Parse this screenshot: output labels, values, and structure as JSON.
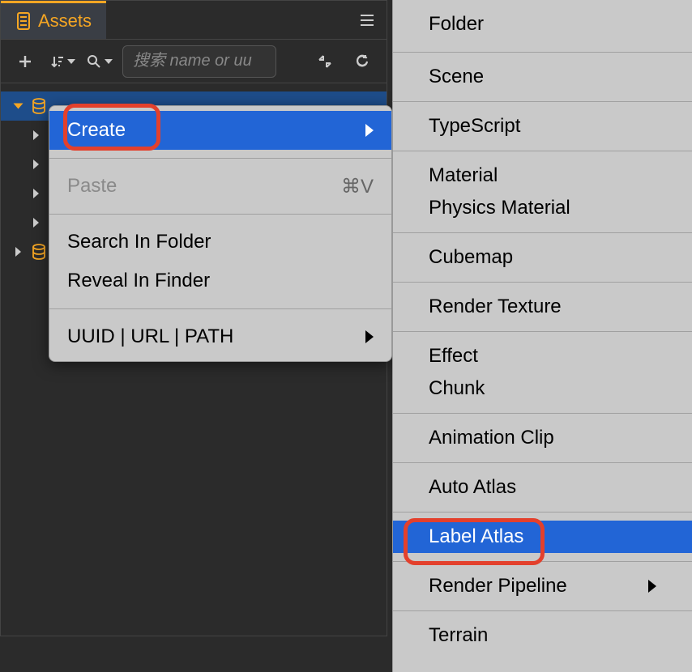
{
  "panel": {
    "tab_label": "Assets"
  },
  "toolbar": {
    "search_placeholder": "搜索 name or uu"
  },
  "ctx": {
    "create": "Create",
    "paste": "Paste",
    "paste_shortcut": "⌘V",
    "search_in_folder": "Search In Folder",
    "reveal_in_finder": "Reveal In Finder",
    "uuid_url_path": "UUID | URL | PATH"
  },
  "submenu": {
    "items": [
      {
        "label": "Folder"
      },
      {
        "sep": true
      },
      {
        "label": "Scene"
      },
      {
        "sep": true
      },
      {
        "label": "TypeScript"
      },
      {
        "sep": true
      },
      {
        "label": "Material"
      },
      {
        "label": "Physics Material"
      },
      {
        "sep": true
      },
      {
        "label": "Cubemap"
      },
      {
        "sep": true
      },
      {
        "label": "Render Texture"
      },
      {
        "sep": true
      },
      {
        "label": "Effect"
      },
      {
        "label": "Chunk"
      },
      {
        "sep": true
      },
      {
        "label": "Animation Clip"
      },
      {
        "sep": true
      },
      {
        "label": "Auto Atlas"
      },
      {
        "sep": true
      },
      {
        "label": "Label Atlas",
        "highlighted": true
      },
      {
        "sep": true
      },
      {
        "label": "Render Pipeline",
        "hasSub": true
      },
      {
        "sep": true
      },
      {
        "label": "Terrain"
      }
    ]
  }
}
